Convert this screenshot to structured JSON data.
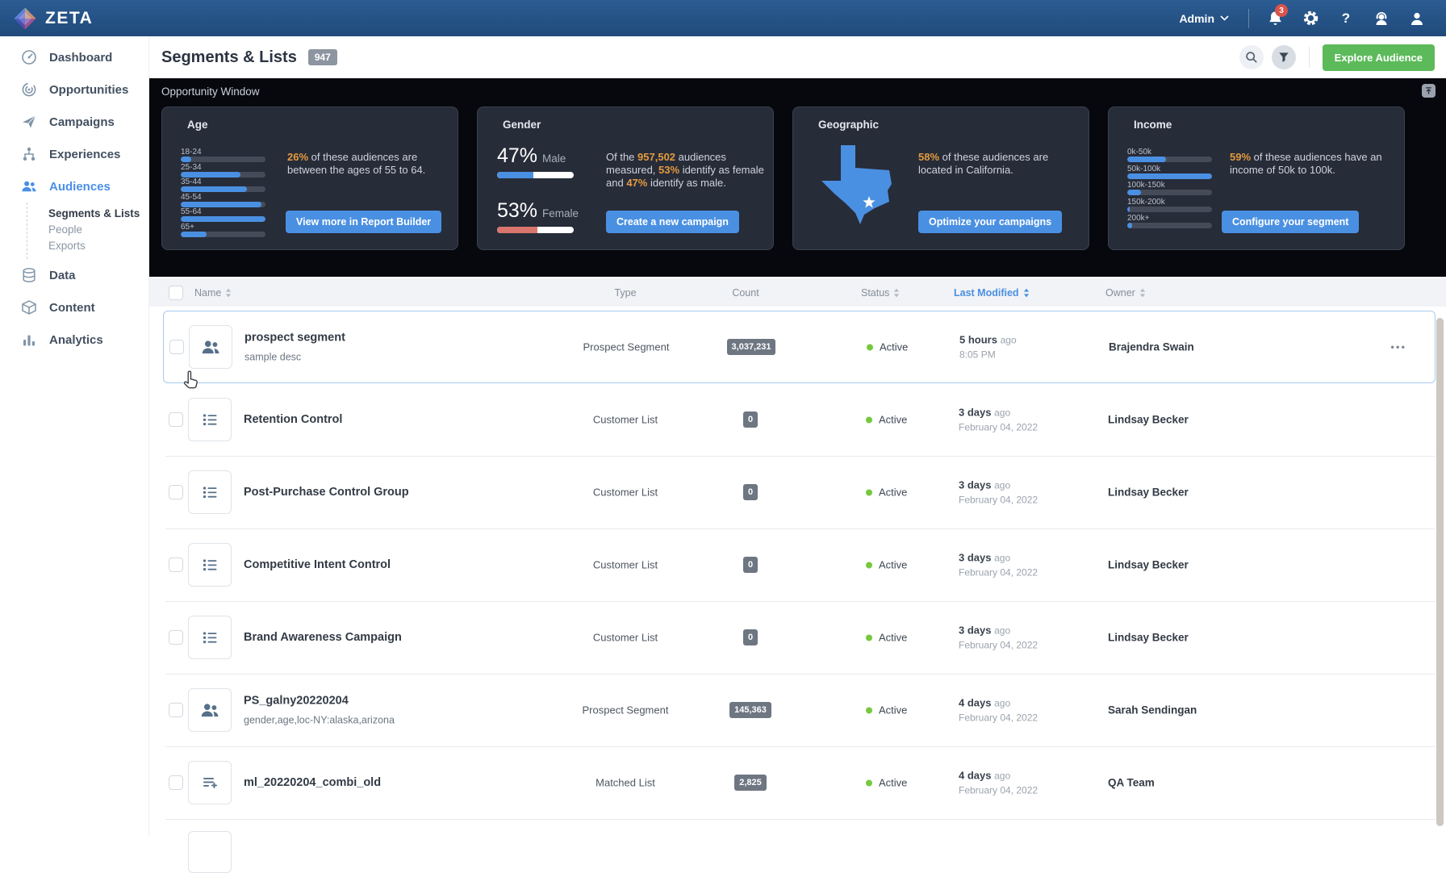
{
  "navbar": {
    "brand": "ZETA",
    "admin_label": "Admin",
    "notification_count": "3"
  },
  "sidebar": {
    "items": [
      {
        "label": "Dashboard",
        "icon": "dashboard-icon"
      },
      {
        "label": "Opportunities",
        "icon": "opportunities-icon"
      },
      {
        "label": "Campaigns",
        "icon": "campaigns-icon"
      },
      {
        "label": "Experiences",
        "icon": "experiences-icon"
      },
      {
        "label": "Audiences",
        "icon": "audiences-icon",
        "active": true
      },
      {
        "label": "Data",
        "icon": "data-icon"
      },
      {
        "label": "Content",
        "icon": "content-icon"
      },
      {
        "label": "Analytics",
        "icon": "analytics-icon"
      }
    ],
    "audiences_children": [
      {
        "label": "Segments & Lists",
        "active": true
      },
      {
        "label": "People"
      },
      {
        "label": "Exports"
      }
    ]
  },
  "header": {
    "title": "Segments & Lists",
    "count_badge": "947",
    "explore_button": "Explore Audience"
  },
  "opportunity": {
    "title": "Opportunity Window",
    "age": {
      "title": "Age",
      "chart": {
        "type": "bar",
        "categories": [
          "18-24",
          "25-34",
          "35-44",
          "45-54",
          "55-64",
          "65+"
        ],
        "values_pct": [
          12,
          70,
          78,
          95,
          100,
          30
        ]
      },
      "stat": "26%",
      "text": " of these audiences are between the ages of 55 to 64.",
      "button": "View more in Report Builder"
    },
    "gender": {
      "title": "Gender",
      "male_pct": "47%",
      "male_label": "Male",
      "male_fill": 47,
      "female_pct": "53%",
      "female_label": "Female",
      "female_fill": 53,
      "text_segments": [
        {
          "t": "Of the "
        },
        {
          "t": "957,502"
        },
        {
          "t": " audiences measured, "
        },
        {
          "t": "53%"
        },
        {
          "t": " identify as female and "
        },
        {
          "t": "47%"
        },
        {
          "t": " identify as male."
        }
      ],
      "button": "Create a new campaign"
    },
    "geographic": {
      "title": "Geographic",
      "stat": "58%",
      "text": " of these audiences are located in California.",
      "button": "Optimize your campaigns"
    },
    "income": {
      "title": "Income",
      "chart": {
        "type": "bar",
        "categories": [
          "0k-50k",
          "50k-100k",
          "100k-150k",
          "150k-200k",
          "200k+"
        ],
        "values_pct": [
          46,
          100,
          16,
          3,
          6
        ]
      },
      "stat": "59%",
      "text": " of these audiences have an income of 50k to 100k.",
      "button": "Configure your segment"
    }
  },
  "table": {
    "columns": {
      "name": "Name",
      "type": "Type",
      "count": "Count",
      "status": "Status",
      "last_modified": "Last Modified",
      "owner": "Owner"
    },
    "ago_label": "ago",
    "menu_icon": "•••",
    "rows": [
      {
        "name": "prospect segment",
        "desc": "sample desc",
        "icon": "people-icon",
        "type": "Prospect Segment",
        "count": "3,037,231",
        "status": "Active",
        "modified": "5 hours",
        "modified_detail": "8:05 PM",
        "owner": "Brajendra Swain"
      },
      {
        "name": "Retention Control",
        "icon": "list-icon",
        "type": "Customer List",
        "count": "0",
        "status": "Active",
        "modified": "3 days",
        "modified_detail": "February 04, 2022",
        "owner": "Lindsay Becker"
      },
      {
        "name": "Post-Purchase Control Group",
        "icon": "list-icon",
        "type": "Customer List",
        "count": "0",
        "status": "Active",
        "modified": "3 days",
        "modified_detail": "February 04, 2022",
        "owner": "Lindsay Becker"
      },
      {
        "name": "Competitive Intent Control",
        "icon": "list-icon",
        "type": "Customer List",
        "count": "0",
        "status": "Active",
        "modified": "3 days",
        "modified_detail": "February 04, 2022",
        "owner": "Lindsay Becker"
      },
      {
        "name": "Brand Awareness Campaign",
        "icon": "list-icon",
        "type": "Customer List",
        "count": "0",
        "status": "Active",
        "modified": "3 days",
        "modified_detail": "February 04, 2022",
        "owner": "Lindsay Becker"
      },
      {
        "name": "PS_galny20220204",
        "desc": "gender,age,loc-NY:alaska,arizona",
        "icon": "people-icon",
        "type": "Prospect Segment",
        "count": "145,363",
        "status": "Active",
        "modified": "4 days",
        "modified_detail": "February 04, 2022",
        "owner": "Sarah Sendingan"
      },
      {
        "name": "ml_20220204_combi_old",
        "icon": "list-plus-icon",
        "type": "Matched List",
        "count": "2,825",
        "status": "Active",
        "modified": "4 days",
        "modified_detail": "February 04, 2022",
        "owner": "QA Team"
      }
    ]
  },
  "colors": {
    "accent_blue": "#4a90e2",
    "highlight_orange": "#e59b3f",
    "success_green": "#5cba5a",
    "status_green": "#76c93e",
    "female_red": "#d9756c",
    "navbar_blue": "#20507f"
  }
}
